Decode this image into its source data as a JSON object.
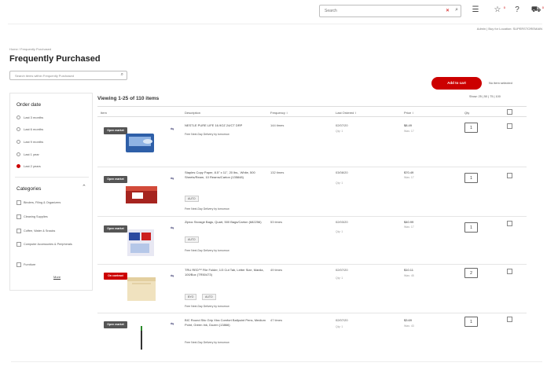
{
  "header": {
    "search_placeholder": "Search",
    "clear_glyph": "✕",
    "search_icon": "search-icon",
    "icons": [
      {
        "name": "lists-icon",
        "glyph": "☰",
        "badge": ""
      },
      {
        "name": "rewards-icon",
        "glyph": "☆",
        "badge": "0"
      },
      {
        "name": "help-icon",
        "glyph": "?",
        "badge": ""
      },
      {
        "name": "cart-icon",
        "glyph": "⛟",
        "badge": "0"
      }
    ]
  },
  "subbar": {
    "right_text": "Admin  |  Buy for Location: SUPERSTOREMAIN"
  },
  "breadcrumb": "Home / Frequently Purchased",
  "page_title": "Frequently Purchased",
  "pf_search": {
    "placeholder": "Search items within Frequently Purchased",
    "icon": "search-icon"
  },
  "actions": {
    "add_to_cart": "Add to cart",
    "no_selection": "No item selected"
  },
  "sidebar": {
    "order_date_heading": "Order date",
    "order_date_options": [
      {
        "label": "Last 3 months",
        "selected": false
      },
      {
        "label": "Last 6 months",
        "selected": false
      },
      {
        "label": "Last 9 months",
        "selected": false
      },
      {
        "label": "Last 1 year",
        "selected": false
      },
      {
        "label": "Last 2 years",
        "selected": true
      }
    ],
    "categories_heading": "Categories",
    "categories": [
      "Binders, Filing & Organizers",
      "Cleaning Supplies",
      "Coffee, Water & Snacks",
      "Computer Accessories & Peripherals",
      "Furniture"
    ],
    "more_label": "More"
  },
  "results": {
    "viewing": "Viewing 1-25 of 110 items",
    "show": "Show: 25 | 50 | 75 | 100"
  },
  "table": {
    "headers": {
      "item": "Item",
      "description": "Description",
      "frequency": "Frequency ↕",
      "last_ordered": "Last Ordered ↕",
      "price": "Price ↕",
      "qty": "Qty"
    },
    "rows": [
      {
        "badge": "Open market",
        "badge_color": "#555555",
        "description": "NESTLE PURE LIFE 16.9OZ 24/CT DRP",
        "tags": [],
        "delivery": "Free Next-Day Delivery by tomorrow",
        "frequency": "144 times",
        "last_ordered": "02/07/20",
        "last_sub": "Qty: 1",
        "price": "$8.49",
        "price_sub": "Was: 17",
        "qty": "1"
      },
      {
        "badge": "Open market",
        "badge_color": "#555555",
        "description": "Staples Copy Paper, 8.5\" x 11\", 20 lbs., White, 500 Sheets/Ream, 10 Reams/Carton (135848)",
        "tags": [
          "AUTO"
        ],
        "delivery": "Free Next-Day Delivery by tomorrow",
        "frequency": "132 times",
        "last_ordered": "03/08/20",
        "last_sub": "Qty: 1",
        "price": "$70.49",
        "price_sub": "Was: 17",
        "qty": "1"
      },
      {
        "badge": "Open market",
        "badge_color": "#555555",
        "description": "Ziploc Storage Bags, Quart, 500 Bags/Carton (682256)",
        "tags": [
          "AUTO"
        ],
        "delivery": "Free Next-Day Delivery by tomorrow",
        "frequency": "53 times",
        "last_ordered": "02/03/20",
        "last_sub": "Qty: 1",
        "price": "$40.99",
        "price_sub": "Was: 17",
        "qty": "1"
      },
      {
        "badge": "On contract",
        "badge_color": "#cc0000",
        "description": "TRU RED™ File Folder, 1/3 Cut Tab, Letter Size, Manila, 100/Box (TR50473)",
        "tags": [
          "BYO",
          "AUTO"
        ],
        "delivery": "Free Next-Day Delivery by tomorrow",
        "frequency": "49 times",
        "last_ordered": "02/07/20",
        "last_sub": "Qty: 1",
        "price": "$10.11",
        "price_sub": "Was: 45",
        "qty": "2"
      },
      {
        "badge": "Open market",
        "badge_color": "#555555",
        "description": "BIC Round Stic Grip Xtra Comfort Ballpoint Pens, Medium Point, Green Ink, Dozen (13866)",
        "tags": [],
        "delivery": "Free Next-Day Delivery by tomorrow",
        "frequency": "47 times",
        "last_ordered": "02/07/20",
        "last_sub": "Qty: 1",
        "price": "$3.69",
        "price_sub": "Was: 43",
        "qty": "1"
      }
    ]
  }
}
